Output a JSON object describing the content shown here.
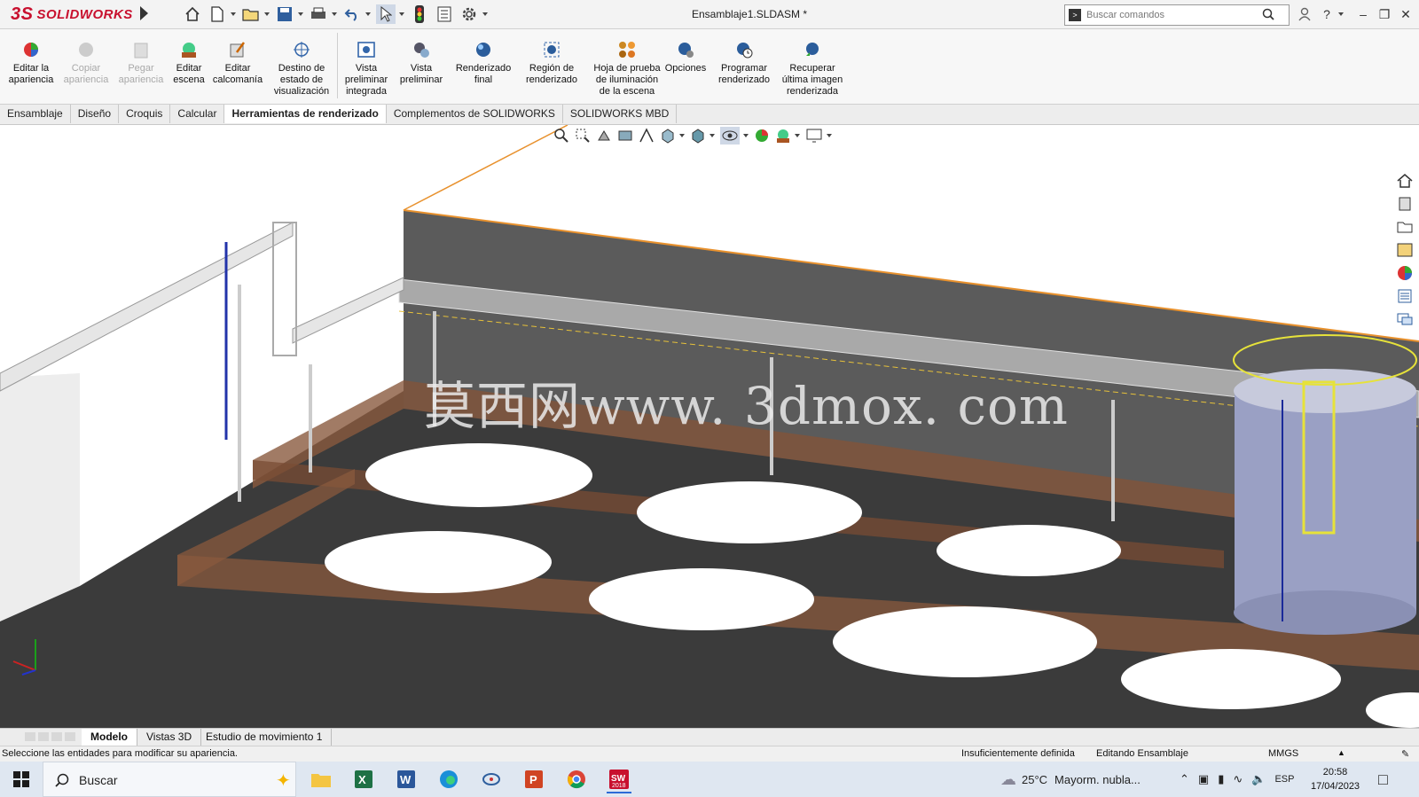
{
  "app": {
    "brand": "SOLIDWORKS",
    "brand_prefix": "3S",
    "document_title": "Ensamblaje1.SLDASM *",
    "search": {
      "placeholder": "Buscar comandos"
    }
  },
  "ribbon": {
    "buttons": [
      {
        "label": "Editar la\napariencia",
        "enabled": true,
        "icon": "edit-appearance-icon"
      },
      {
        "label": "Copiar\napariencia",
        "enabled": false,
        "icon": "copy-appearance-icon"
      },
      {
        "label": "Pegar\napariencia",
        "enabled": false,
        "icon": "paste-appearance-icon"
      },
      {
        "label": "Editar\nescena",
        "enabled": true,
        "icon": "edit-scene-icon"
      },
      {
        "label": "Editar\ncalcomanía",
        "enabled": true,
        "icon": "edit-decal-icon"
      },
      {
        "label": "Destino de\nestado de\nvisualización",
        "enabled": true,
        "icon": "display-state-target-icon"
      },
      {
        "label": "Vista\npreliminar\nintegrada",
        "enabled": true,
        "icon": "integrated-preview-icon"
      },
      {
        "label": "Vista\npreliminar",
        "enabled": true,
        "icon": "preview-window-icon"
      },
      {
        "label": "Renderizado\nfinal",
        "enabled": true,
        "icon": "final-render-icon"
      },
      {
        "label": "Región de\nrenderizado",
        "enabled": true,
        "icon": "render-region-icon"
      },
      {
        "label": "Hoja de prueba\nde iluminación\nde la escena",
        "enabled": true,
        "icon": "scene-illumination-proof-sheet-icon"
      },
      {
        "label": "Opciones",
        "enabled": true,
        "icon": "options-icon"
      },
      {
        "label": "Programar\nrenderizado",
        "enabled": true,
        "icon": "schedule-render-icon"
      },
      {
        "label": "Recuperar\núltima imagen\nrenderizada",
        "enabled": true,
        "icon": "recall-last-render-icon"
      }
    ]
  },
  "command_tabs": [
    {
      "label": "Ensamblaje",
      "active": false
    },
    {
      "label": "Diseño",
      "active": false
    },
    {
      "label": "Croquis",
      "active": false
    },
    {
      "label": "Calcular",
      "active": false
    },
    {
      "label": "Herramientas de renderizado",
      "active": true
    },
    {
      "label": "Complementos de SOLIDWORKS",
      "active": false
    },
    {
      "label": "SOLIDWORKS MBD",
      "active": false
    }
  ],
  "viewport": {
    "watermark": "莫西网www. 3dmox. com",
    "colors": {
      "wall": "#5b5b5b",
      "wall_edge": "#e8912d",
      "floor": "#3a3a3a",
      "trench": "#8a5a3e",
      "tank": "#9aa0c4",
      "railing": "#e6e23a"
    }
  },
  "bottom_tabs": [
    {
      "label": "Modelo",
      "active": true
    },
    {
      "label": "Vistas 3D",
      "active": false
    },
    {
      "label": "Estudio de movimiento 1",
      "active": false
    }
  ],
  "status": {
    "hint": "Seleccione las entidades para modificar su apariencia.",
    "definition": "Insuficientemente definida",
    "mode": "Editando Ensamblaje",
    "units": "MMGS"
  },
  "taskbar": {
    "search_label": "Buscar",
    "weather_temp": "25°C",
    "weather_text": "Mayorm. nubla...",
    "language": "ESP",
    "time": "20:58",
    "date": "17/04/2023",
    "apps": [
      "file-explorer-icon",
      "excel-icon",
      "word-icon",
      "edge-icon",
      "app-icon",
      "powerpoint-icon",
      "chrome-icon",
      "solidworks-taskbar-icon"
    ],
    "solidworks_badge": "2018"
  }
}
